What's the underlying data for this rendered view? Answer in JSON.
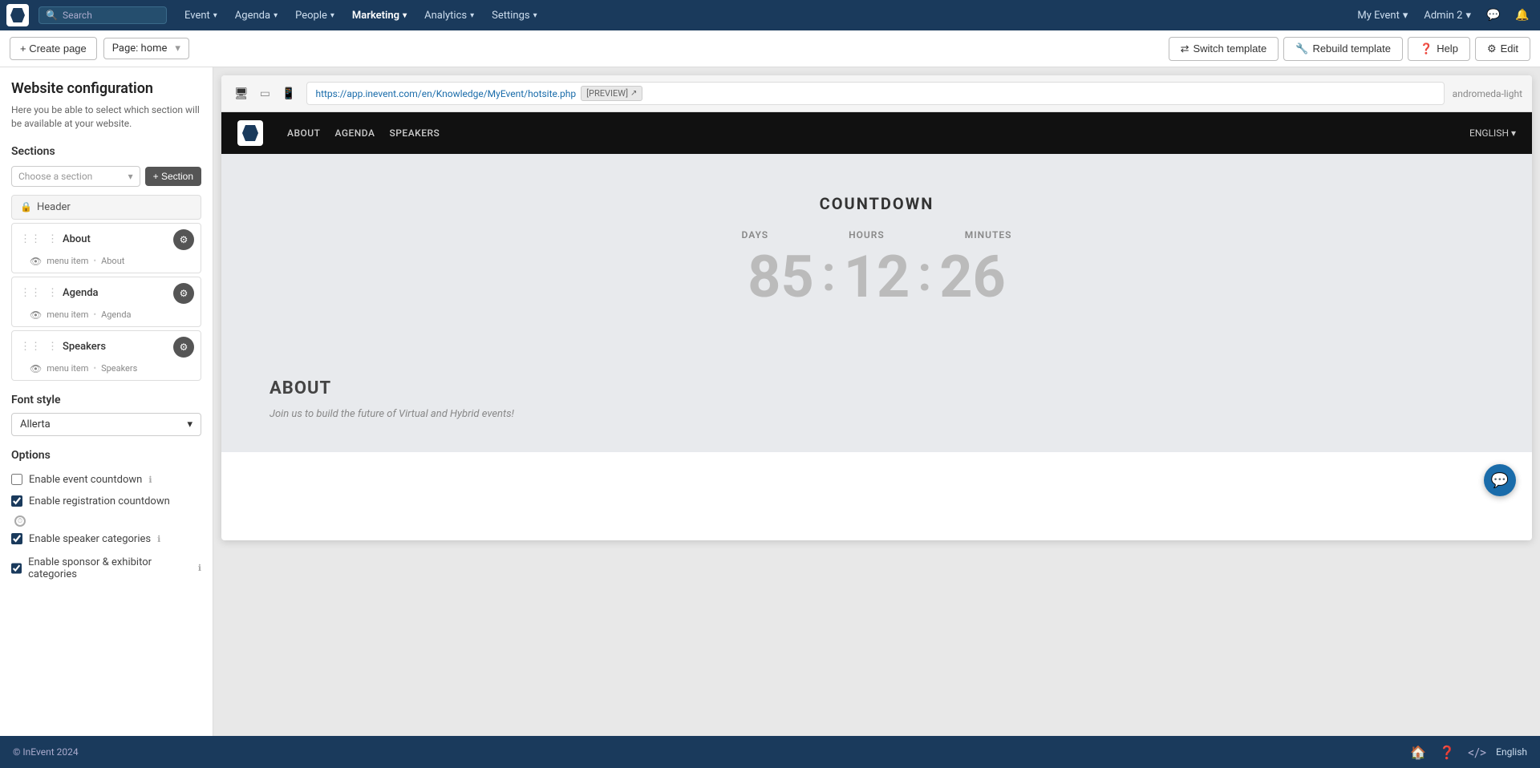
{
  "app": {
    "logo_label": "InEvent",
    "copyright": "© InEvent 2024"
  },
  "top_nav": {
    "search_placeholder": "Search",
    "items": [
      {
        "id": "event",
        "label": "Event",
        "has_dropdown": true
      },
      {
        "id": "agenda",
        "label": "Agenda",
        "has_dropdown": true
      },
      {
        "id": "people",
        "label": "People",
        "has_dropdown": true
      },
      {
        "id": "marketing",
        "label": "Marketing",
        "has_dropdown": true,
        "active": true
      },
      {
        "id": "analytics",
        "label": "Analytics",
        "has_dropdown": true
      },
      {
        "id": "settings",
        "label": "Settings",
        "has_dropdown": true
      }
    ],
    "event_name": "My Event",
    "admin_name": "Admin 2",
    "chevron": "▾"
  },
  "toolbar": {
    "create_page_label": "+ Create page",
    "page_selector_label": "Page: home",
    "switch_template_label": "Switch template",
    "rebuild_template_label": "Rebuild template",
    "help_label": "Help",
    "edit_label": "Edit"
  },
  "sidebar": {
    "title": "Website configuration",
    "subtitle": "Here you be able to select which section will be available at your website.",
    "sections_label": "Sections",
    "choose_section_placeholder": "Choose a section",
    "add_section_label": "+ Section",
    "header_item_label": "Header",
    "sections": [
      {
        "id": "about",
        "name": "About",
        "meta_type": "menu item",
        "meta_name": "About"
      },
      {
        "id": "agenda",
        "name": "Agenda",
        "meta_type": "menu item",
        "meta_name": "Agenda"
      },
      {
        "id": "speakers",
        "name": "Speakers",
        "meta_type": "menu item",
        "meta_name": "Speakers"
      }
    ],
    "font_style_label": "Font style",
    "font_selected": "Allerta",
    "options_label": "Options",
    "options": [
      {
        "id": "event-countdown",
        "label": "Enable event countdown",
        "checked": false,
        "has_info": true,
        "has_clock": false
      },
      {
        "id": "registration-countdown",
        "label": "Enable registration countdown",
        "checked": true,
        "has_info": false,
        "has_clock": true
      },
      {
        "id": "speaker-categories",
        "label": "Enable speaker categories",
        "checked": true,
        "has_info": true,
        "has_clock": false
      },
      {
        "id": "sponsor-categories",
        "label": "Enable sponsor & exhibitor categories",
        "checked": true,
        "has_info": true,
        "has_clock": false
      }
    ]
  },
  "preview": {
    "url": "https://app.inevent.com/en/Knowledge/MyEvent/hotsite.php",
    "preview_label": "[PREVIEW]",
    "template_name": "andromeda-light",
    "site_nav": {
      "links": [
        "ABOUT",
        "AGENDA",
        "SPEAKERS"
      ],
      "language": "ENGLISH ▾"
    },
    "countdown": {
      "title": "COUNTDOWN",
      "labels": [
        "DAYS",
        "HOURS",
        "MINUTES"
      ],
      "days": "85",
      "hours": "12",
      "minutes": "26"
    },
    "about": {
      "title": "ABOUT",
      "text": "Join us to build the future of Virtual and Hybrid events!"
    }
  },
  "footer": {
    "copyright": "© InEvent 2024",
    "language": "English"
  }
}
